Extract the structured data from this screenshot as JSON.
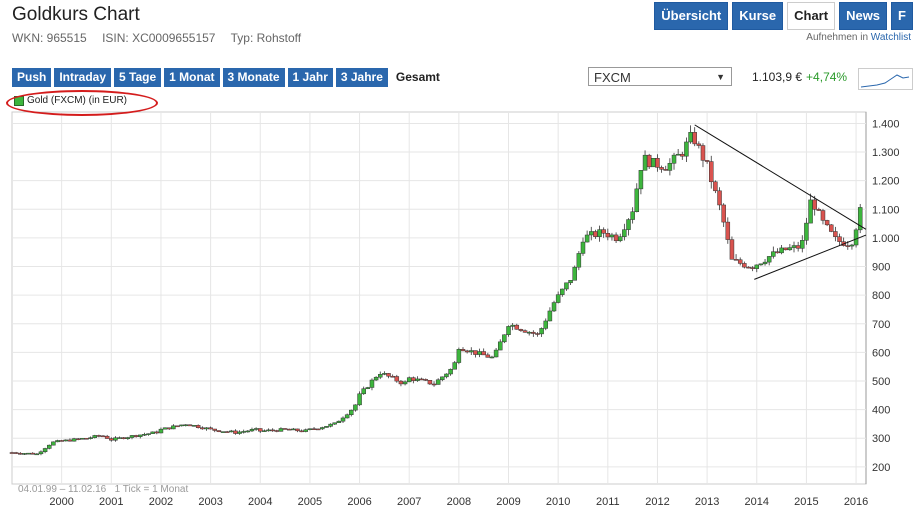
{
  "header": {
    "title": "Goldkurs Chart",
    "wkn": "WKN: 965515",
    "isin": "ISIN: XC0009655157",
    "typ": "Typ: Rohstoff",
    "watch_text": "Aufnehmen in",
    "watch_link": "Watchlist"
  },
  "nav": {
    "tabs": [
      {
        "label": "Übersicht"
      },
      {
        "label": "Kurse"
      },
      {
        "label": "Chart"
      },
      {
        "label": "News"
      },
      {
        "label": "F"
      }
    ]
  },
  "ranges": {
    "buttons": [
      {
        "label": "Push"
      },
      {
        "label": "Intraday"
      },
      {
        "label": "5 Tage"
      },
      {
        "label": "1 Monat"
      },
      {
        "label": "3 Monate"
      },
      {
        "label": "1 Jahr"
      },
      {
        "label": "3 Jahre"
      },
      {
        "label": "Gesamt"
      }
    ]
  },
  "exchange": {
    "value": "FXCM",
    "arrow": "▼"
  },
  "quote": {
    "price": "1.103,9 €",
    "change": "+4,74%"
  },
  "legend": {
    "label": "Gold (FXCM) (in EUR)"
  },
  "footer": {
    "range": "04.01.99 – 11.02.16",
    "interval": "1 Tick = 1 Monat"
  },
  "colors": {
    "up": "#3db53d",
    "down": "#d9534f",
    "accent": "#2a67ad",
    "annotation": "#d41c1c"
  },
  "chart_data": {
    "type": "candlestick",
    "x_ticks": [
      "2000",
      "2001",
      "2002",
      "2003",
      "2004",
      "2005",
      "2006",
      "2007",
      "2008",
      "2009",
      "2010",
      "2011",
      "2012",
      "2013",
      "2014",
      "2015",
      "2016"
    ],
    "y_ticks": [
      "200",
      "300",
      "400",
      "500",
      "600",
      "700",
      "800",
      "900",
      "1.000",
      "1.100",
      "1.200",
      "1.300",
      "1.400"
    ],
    "ylim": [
      140,
      1440
    ],
    "xlim": [
      1999.0,
      2016.2
    ],
    "series_name": "Gold (FXCM) (in EUR)",
    "monthly_close": [
      {
        "t": 1999.0,
        "v": 250
      },
      {
        "t": 1999.5,
        "v": 245
      },
      {
        "t": 1999.8,
        "v": 285
      },
      {
        "t": 2000.0,
        "v": 290
      },
      {
        "t": 2000.5,
        "v": 300
      },
      {
        "t": 2000.8,
        "v": 310
      },
      {
        "t": 2001.0,
        "v": 295
      },
      {
        "t": 2001.5,
        "v": 310
      },
      {
        "t": 2001.9,
        "v": 320
      },
      {
        "t": 2002.0,
        "v": 330
      },
      {
        "t": 2002.5,
        "v": 350
      },
      {
        "t": 2002.9,
        "v": 335
      },
      {
        "t": 2003.0,
        "v": 330
      },
      {
        "t": 2003.5,
        "v": 320
      },
      {
        "t": 2003.9,
        "v": 330
      },
      {
        "t": 2004.0,
        "v": 325
      },
      {
        "t": 2004.5,
        "v": 330
      },
      {
        "t": 2004.9,
        "v": 325
      },
      {
        "t": 2005.0,
        "v": 330
      },
      {
        "t": 2005.5,
        "v": 350
      },
      {
        "t": 2005.9,
        "v": 410
      },
      {
        "t": 2006.0,
        "v": 450
      },
      {
        "t": 2006.4,
        "v": 530
      },
      {
        "t": 2006.9,
        "v": 490
      },
      {
        "t": 2007.0,
        "v": 510
      },
      {
        "t": 2007.5,
        "v": 490
      },
      {
        "t": 2007.9,
        "v": 550
      },
      {
        "t": 2008.0,
        "v": 620
      },
      {
        "t": 2008.3,
        "v": 600
      },
      {
        "t": 2008.7,
        "v": 580
      },
      {
        "t": 2009.0,
        "v": 700
      },
      {
        "t": 2009.3,
        "v": 680
      },
      {
        "t": 2009.6,
        "v": 660
      },
      {
        "t": 2009.9,
        "v": 770
      },
      {
        "t": 2010.3,
        "v": 870
      },
      {
        "t": 2010.5,
        "v": 1000
      },
      {
        "t": 2010.9,
        "v": 1020
      },
      {
        "t": 2011.2,
        "v": 1000
      },
      {
        "t": 2011.5,
        "v": 1100
      },
      {
        "t": 2011.7,
        "v": 1280
      },
      {
        "t": 2011.9,
        "v": 1260
      },
      {
        "t": 2012.2,
        "v": 1250
      },
      {
        "t": 2012.5,
        "v": 1300
      },
      {
        "t": 2012.7,
        "v": 1360
      },
      {
        "t": 2013.0,
        "v": 1250
      },
      {
        "t": 2013.3,
        "v": 1080
      },
      {
        "t": 2013.5,
        "v": 920
      },
      {
        "t": 2013.9,
        "v": 900
      },
      {
        "t": 2014.3,
        "v": 940
      },
      {
        "t": 2014.6,
        "v": 960
      },
      {
        "t": 2014.9,
        "v": 970
      },
      {
        "t": 2015.1,
        "v": 1140
      },
      {
        "t": 2015.3,
        "v": 1060
      },
      {
        "t": 2015.6,
        "v": 990
      },
      {
        "t": 2015.9,
        "v": 980
      },
      {
        "t": 2016.0,
        "v": 1040
      },
      {
        "t": 2016.1,
        "v": 1104
      }
    ],
    "trendlines": [
      {
        "from": [
          2012.75,
          1395
        ],
        "to": [
          2016.2,
          1030
        ]
      },
      {
        "from": [
          2013.95,
          855
        ],
        "to": [
          2016.2,
          1010
        ]
      }
    ],
    "grid": true
  }
}
